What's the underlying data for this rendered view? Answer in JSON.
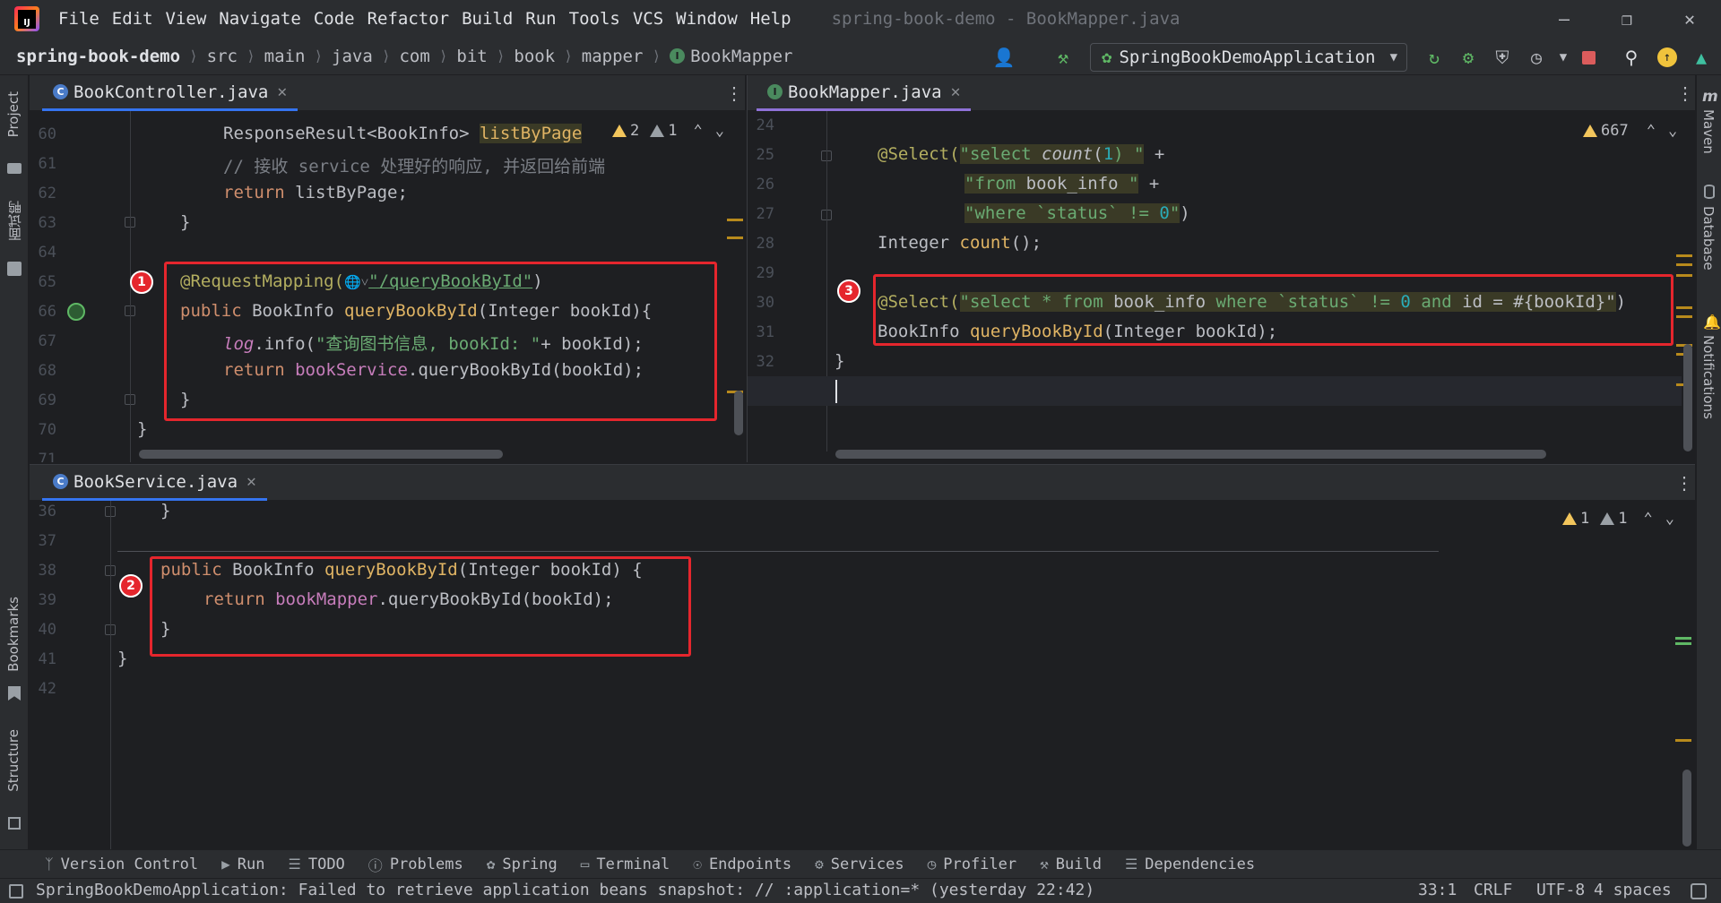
{
  "window": {
    "title": "spring-book-demo - BookMapper.java",
    "menu": [
      "File",
      "Edit",
      "View",
      "Navigate",
      "Code",
      "Refactor",
      "Build",
      "Run",
      "Tools",
      "VCS",
      "Window",
      "Help"
    ]
  },
  "breadcrumb": [
    "spring-book-demo",
    "src",
    "main",
    "java",
    "com",
    "bit",
    "book",
    "mapper",
    "BookMapper"
  ],
  "run_config": "SpringBookDemoApplication",
  "left_tools": [
    "Project",
    "面试鸭",
    "Bookmarks",
    "Structure"
  ],
  "right_tools": [
    "Maven",
    "Database",
    "Notifications"
  ],
  "pane_controller": {
    "tab": "BookController.java",
    "warnings": {
      "yellow": "2",
      "grey": "1"
    },
    "lines": [
      "60",
      "61",
      "62",
      "63",
      "64",
      "65",
      "66",
      "67",
      "68",
      "69",
      "70",
      "71"
    ],
    "code": {
      "l60a": "ResponseResult<BookInfo> ",
      "l60b": "listByPage",
      "l61": "// 接收 service 处理好的响应, 并返回给前端",
      "l62a": "return ",
      "l62b": "listByPage;",
      "l63": "}",
      "l65a": "@RequestMapping(",
      "l65b": "\"/queryBookById\"",
      "l65c": ")",
      "l66a": "public ",
      "l66b": "BookInfo ",
      "l66c": "queryBookById",
      "l66d": "(Integer bookId){",
      "l67a": "log",
      ".l67b": "",
      "l67c": ".info(",
      "l67d": "\"查询图书信息, bookId: \"",
      "l67e": "+ bookId);",
      "l68a": "return ",
      "l68b": "bookService",
      ".l68c": "",
      "l68d": ".queryBookById(bookId);",
      "l69": "}",
      "l70": "}"
    },
    "badge": "1"
  },
  "pane_mapper": {
    "tab": "BookMapper.java",
    "warnings": {
      "yellow": "667"
    },
    "lines": [
      "24",
      "25",
      "26",
      "27",
      "28",
      "29",
      "30",
      "31",
      "32",
      "33"
    ],
    "code": {
      "l25a": "@Select(",
      "l25b": "\"select ",
      "l25c": "count",
      "l25d": "(",
      "l25e": "1",
      "l25f": ") \"",
      "l25g": " +",
      "l26a": "\"from ",
      "l26b": "book_info ",
      "l26c": "\"",
      "l26d": " +",
      "l27a": "\"where ",
      "l27b": "`status` != ",
      "l27c": "0",
      "l27d": "\"",
      ")": ")",
      "l28a": "Integer ",
      "l28b": "count",
      "l28c": "();",
      "l30a": "@Select(",
      "l30b": "\"select * from ",
      "l30c": "book_info ",
      "l30d": "where ",
      "l30e": "`status` != ",
      "l30f": "0",
      "l30g": " and ",
      "l30h": "id = #{bookId}\"",
      "l30i": ")",
      "l31a": "BookInfo ",
      "l31b": "queryBookById",
      "l31c": "(Integer bookId);",
      "l32": "}"
    },
    "badge": "3"
  },
  "pane_service": {
    "tab": "BookService.java",
    "warnings": {
      "yellow": "1",
      "grey": "1"
    },
    "lines": [
      "36",
      "37",
      "38",
      "39",
      "40",
      "41",
      "42"
    ],
    "code": {
      "l36": "}",
      "l38a": "public ",
      "l38b": "BookInfo ",
      "l38c": "queryBookById",
      "l38d": "(Integer bookId) {",
      "l39a": "return ",
      "l39b": "bookMapper",
      "l39c": ".queryBookById(bookId);",
      "l40": "}",
      "l41": "}"
    },
    "badge": "2"
  },
  "tool_windows": [
    "Version Control",
    "Run",
    "TODO",
    "Problems",
    "Spring",
    "Terminal",
    "Endpoints",
    "Services",
    "Profiler",
    "Build",
    "Dependencies"
  ],
  "status": {
    "message": "SpringBookDemoApplication: Failed to retrieve application beans snapshot: // :application=* (yesterday 22:42)",
    "position": "33:1",
    "line_sep": "CRLF",
    "encoding": "UTF-8",
    "indent": "4 spaces"
  },
  "colors": {
    "accent": "#3574f0",
    "red_box": "#e5262d",
    "keyword": "#cf8e6d",
    "string": "#6aab73",
    "method": "#e0b464"
  }
}
